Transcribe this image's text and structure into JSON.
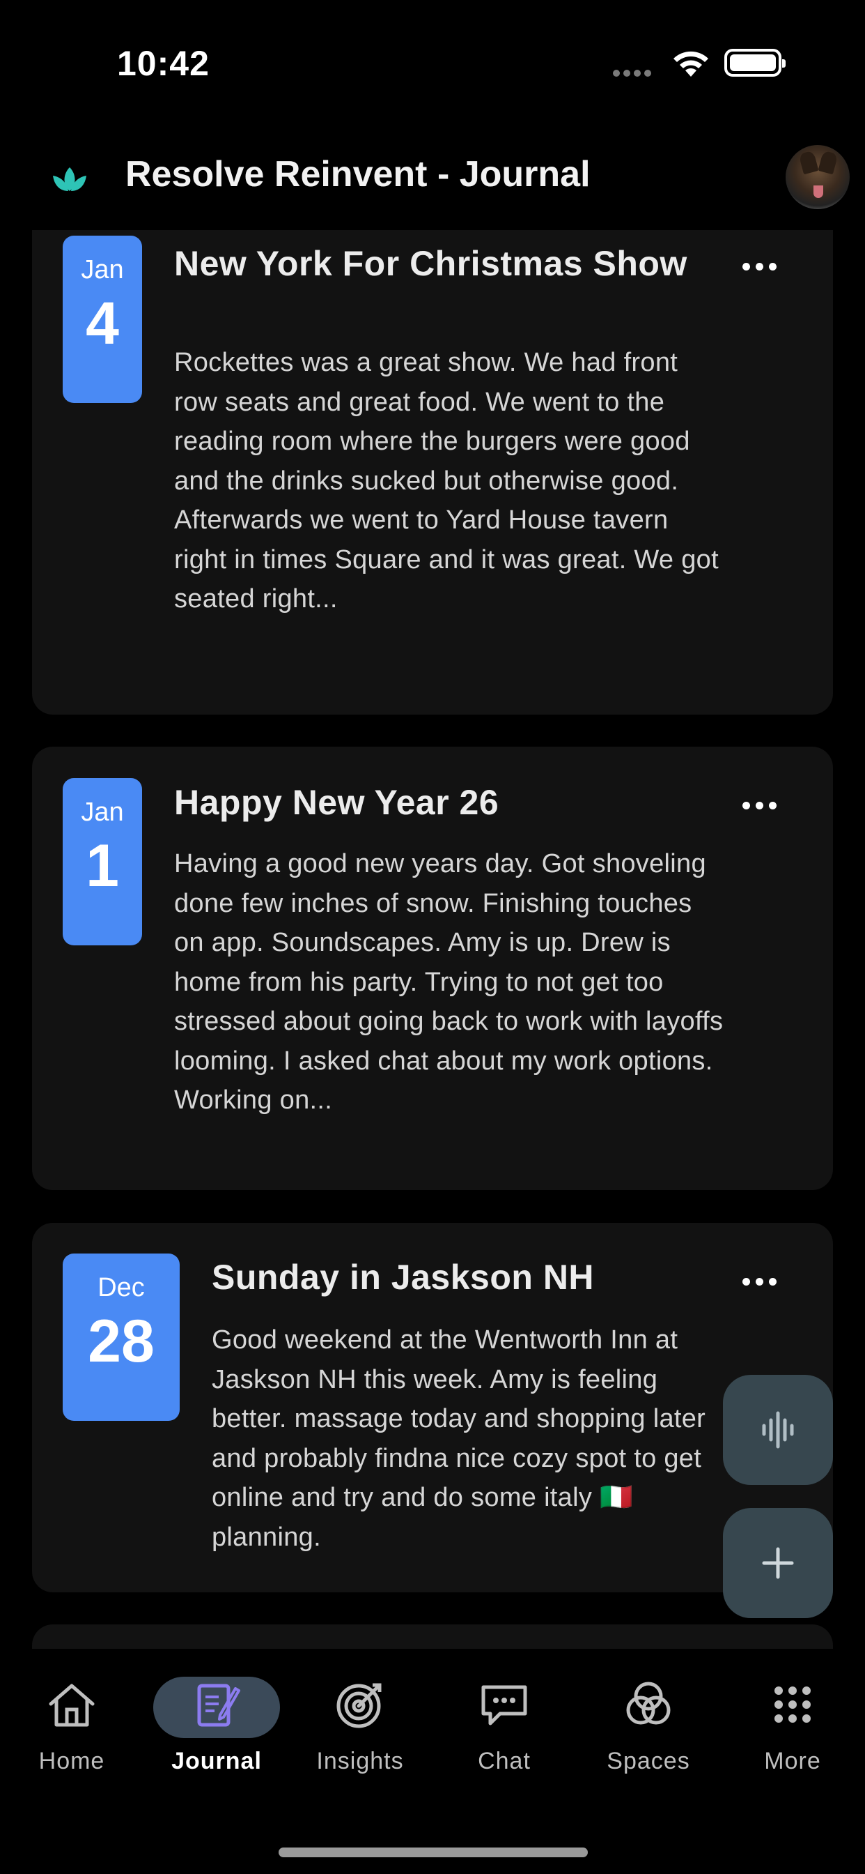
{
  "status_bar": {
    "time": "10:42"
  },
  "header": {
    "title": "Resolve Reinvent - Journal",
    "logo_color": "#2ec4b6"
  },
  "entries": [
    {
      "month": "Jan",
      "day": "4",
      "title": "New York For Christmas Show",
      "body": "Rockettes was a great show. We had front row seats and great food. We went to the reading room where the burgers were good and the drinks sucked but otherwise good. Afterwards we went to Yard House tavern right in times Square and it was great. We got seated right..."
    },
    {
      "month": "Jan",
      "day": "1",
      "title": "Happy New Year 26",
      "body": "Having a good new years day. Got shoveling done few inches of snow. Finishing touches on app. Soundscapes. Amy is up. Drew is home from his party. Trying to not get too stressed about going back to work with layoffs looming. I asked chat about my work options. Working on..."
    },
    {
      "month": "Dec",
      "day": "28",
      "title": "Sunday in Jaskson NH",
      "body": "Good weekend at the Wentworth Inn at Jaskson NH this week. Amy is feeling better. massage today and shopping later and probably findna nice cozy spot to get online and try and do some italy 🇮🇹  planning."
    }
  ],
  "fabs": {
    "voice_icon": "waveform-icon",
    "add_icon": "plus-icon"
  },
  "nav": {
    "items": [
      {
        "label": "Home",
        "icon": "home-icon"
      },
      {
        "label": "Journal",
        "icon": "journal-icon"
      },
      {
        "label": "Insights",
        "icon": "target-icon"
      },
      {
        "label": "Chat",
        "icon": "chat-icon"
      },
      {
        "label": "Spaces",
        "icon": "spaces-icon"
      },
      {
        "label": "More",
        "icon": "grid-icon"
      }
    ],
    "active_index": 1
  },
  "colors": {
    "accent": "#4a8af4",
    "card": "#121212",
    "fab": "#37474f",
    "active_pill": "#3b4a59"
  }
}
